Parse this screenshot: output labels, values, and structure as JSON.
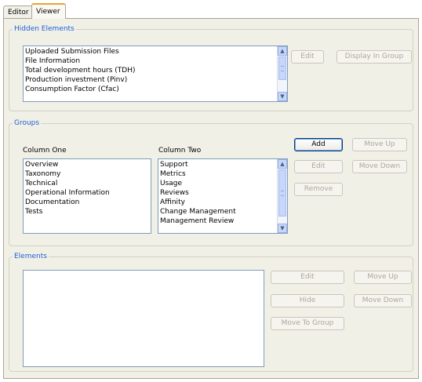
{
  "tabs": [
    {
      "label": "Editor",
      "active": false
    },
    {
      "label": "Viewer",
      "active": true
    }
  ],
  "hidden_elements": {
    "legend": "Hidden Elements",
    "items": [
      "Uploaded Submission Files",
      "File Information",
      "Total development hours (TDH)",
      "Production investment (Pinv)",
      "Consumption Factor (Cfac)"
    ],
    "edit_label": "Edit",
    "display_in_group_label": "Display In Group"
  },
  "groups": {
    "legend": "Groups",
    "column_one_label": "Column One",
    "column_two_label": "Column Two",
    "column_one_items": [
      "Overview",
      "Taxonomy",
      "Technical",
      "Operational Information",
      "Documentation",
      "Tests"
    ],
    "column_two_items": [
      "Support",
      "Metrics",
      "Usage",
      "Reviews",
      "Affinity",
      "Change Management",
      "Management Review"
    ],
    "add_label": "Add",
    "edit_label": "Edit",
    "remove_label": "Remove",
    "move_up_label": "Move Up",
    "move_down_label": "Move Down"
  },
  "elements": {
    "legend": "Elements",
    "items": [],
    "edit_label": "Edit",
    "hide_label": "Hide",
    "move_to_group_label": "Move To Group",
    "move_up_label": "Move Up",
    "move_down_label": "Move Down"
  }
}
